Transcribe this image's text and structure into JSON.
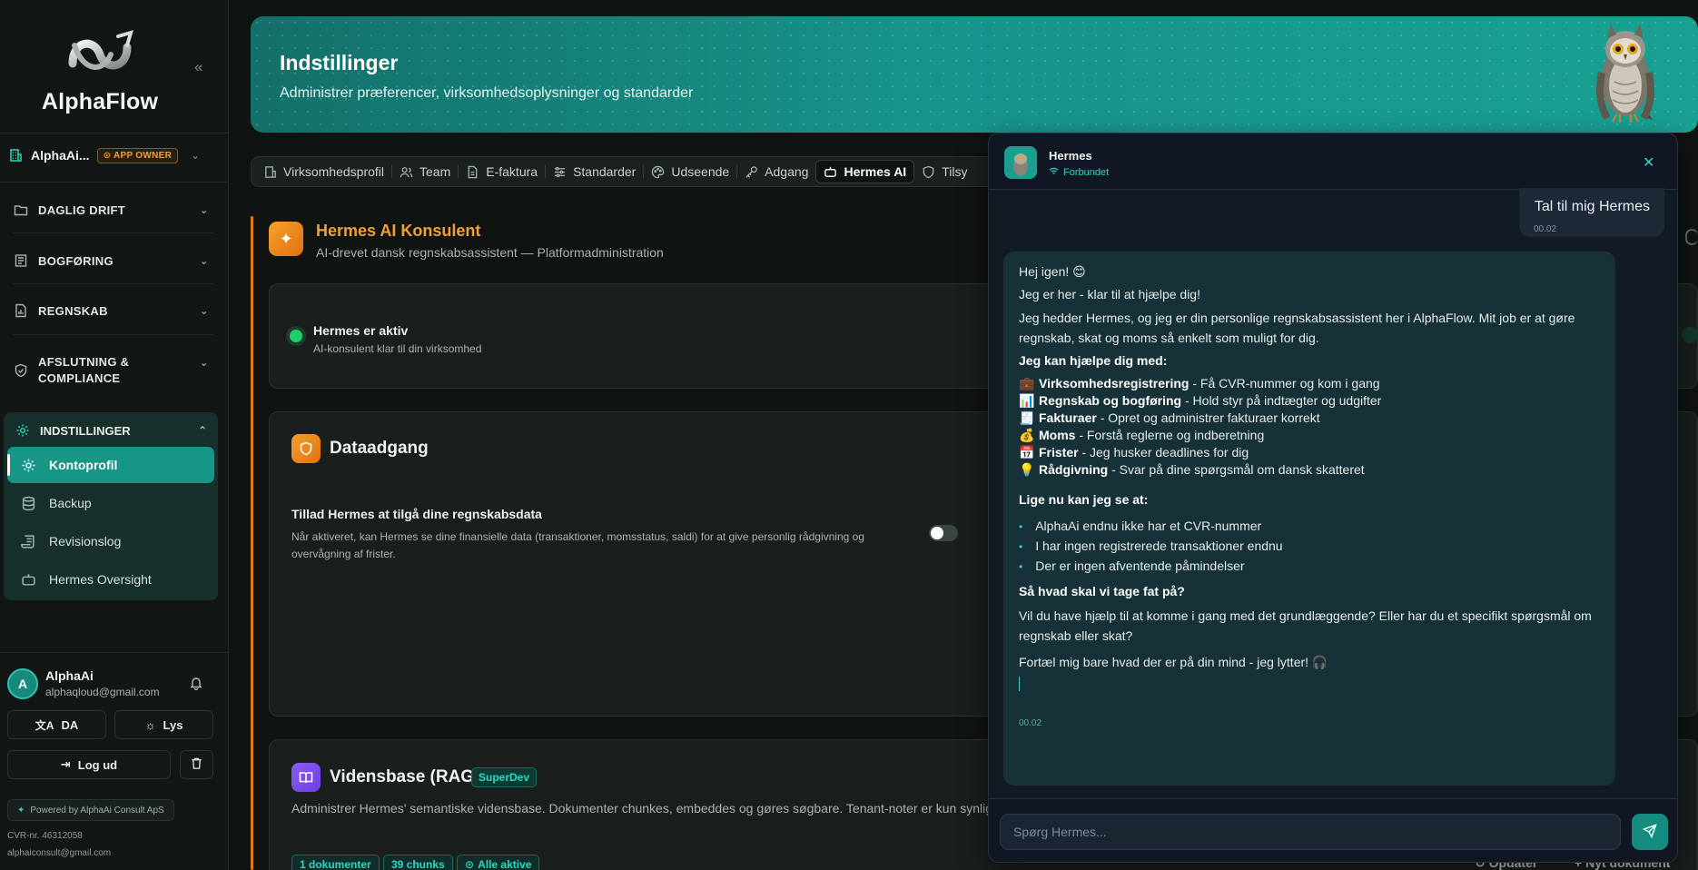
{
  "sidebar": {
    "logo_text": "AlphaFlow",
    "org_name": "AlphaAi...",
    "org_badge": "APP OWNER",
    "sections": [
      {
        "label": "DAGLIG DRIFT"
      },
      {
        "label": "BOGFØRING"
      },
      {
        "label": "REGNSKAB"
      },
      {
        "label": "AFSLUTNING &"
      },
      {
        "label": "COMPLIANCE"
      }
    ],
    "settings": {
      "label": "INDSTILLINGER",
      "items": [
        {
          "label": "Kontoprofil"
        },
        {
          "label": "Backup"
        },
        {
          "label": "Revisionslog"
        },
        {
          "label": "Hermes Oversight"
        }
      ]
    },
    "user": {
      "initial": "A",
      "name": "AlphaAi",
      "email": "alphaqloud@gmail.com"
    },
    "lang_button": "DA",
    "theme_button": "Lys",
    "logout_button": "Log ud",
    "powered": "Powered by AlphaAi Consult ApS",
    "cvr": "CVR-nr. 46312058",
    "contact_email": "alphaiconsult@gmail.com"
  },
  "banner": {
    "title": "Indstillinger",
    "subtitle": "Administrer præferencer, virksomhedsoplysninger og standarder"
  },
  "tabs": [
    {
      "label": "Virksomhedsprofil",
      "icon": "building-icon"
    },
    {
      "label": "Team",
      "icon": "users-icon"
    },
    {
      "label": "E-faktura",
      "icon": "file-icon"
    },
    {
      "label": "Standarder",
      "icon": "sliders-icon"
    },
    {
      "label": "Udseende",
      "icon": "palette-icon"
    },
    {
      "label": "Adgang",
      "icon": "key-icon"
    },
    {
      "label": "Hermes AI",
      "icon": "bot-icon"
    },
    {
      "label": "Tilsy",
      "icon": "shield-icon"
    }
  ],
  "hermes_section": {
    "title": "Hermes AI Konsulent",
    "subtitle": "AI-drevet dansk regnskabsassistent — Platformadministration",
    "status_title": "Hermes er aktiv",
    "status_sub": "AI-konsulent klar til din virksomhed"
  },
  "data_access": {
    "title": "Dataadgang",
    "label": "Tillad Hermes at tilgå dine regnskabsdata",
    "description": "Når aktiveret, kan Hermes se dine finansielle data (transaktioner, momsstatus, saldi) for at give personlig rådgivning og overvågning af frister.",
    "enabled": false
  },
  "rag": {
    "title": "Vidensbase (RAG)",
    "badge": "SuperDev",
    "description": "Administrer Hermes' semantiske vidensbase. Dokumenter chunkes, embeddes og gøres søgbare. Tenant-noter er kun synlige",
    "chips": [
      "1 dokumenter",
      "39 chunks",
      "Alle aktive"
    ],
    "update_label": "Opdater",
    "new_doc_label": "Nyt dokument"
  },
  "chat": {
    "name": "Hermes",
    "status": "Forbundet",
    "user_message": "Tal til mig Hermes",
    "user_time": "00.02",
    "bot": {
      "greeting": "Hej igen! 😊",
      "line2": "Jeg er her - klar til at hjælpe dig!",
      "intro": "Jeg hedder Hermes, og jeg er din personlige regnskabsassistent her i AlphaFlow. Mit job er at gøre regnskab, skat og moms så enkelt som muligt for dig.",
      "help_heading": "Jeg kan hjælpe dig med:",
      "help_items": [
        {
          "emoji": "💼",
          "title": "Virksomhedsregistrering",
          "text": " - Få CVR-nummer og kom i gang"
        },
        {
          "emoji": "📊",
          "title": "Regnskab og bogføring",
          "text": " - Hold styr på indtægter og udgifter"
        },
        {
          "emoji": "🧾",
          "title": "Fakturaer",
          "text": " - Opret og administrer fakturaer korrekt"
        },
        {
          "emoji": "💰",
          "title": "Moms",
          "text": " - Forstå reglerne og indberetning"
        },
        {
          "emoji": "📅",
          "title": "Frister",
          "text": " - Jeg husker deadlines for dig"
        },
        {
          "emoji": "💡",
          "title": "Rådgivning",
          "text": " - Svar på dine spørgsmål om dansk skatteret"
        }
      ],
      "see_heading": "Lige nu kan jeg se at:",
      "see_items": [
        "AlphaAi endnu ikke har et CVR-nummer",
        "I har ingen registrerede transaktioner endnu",
        "Der er ingen afventende påmindelser"
      ],
      "question": "Så hvad skal vi tage fat på?",
      "offer": "Vil du have hjælp til at komme i gang med det grundlæggende? Eller har du et specifikt spørgsmål om regnskab eller skat?",
      "closing": "Fortæl mig bare hvad der er på din mind - jeg lytter! 🎧",
      "time": "00.02"
    },
    "input_placeholder": "Spørg Hermes..."
  }
}
